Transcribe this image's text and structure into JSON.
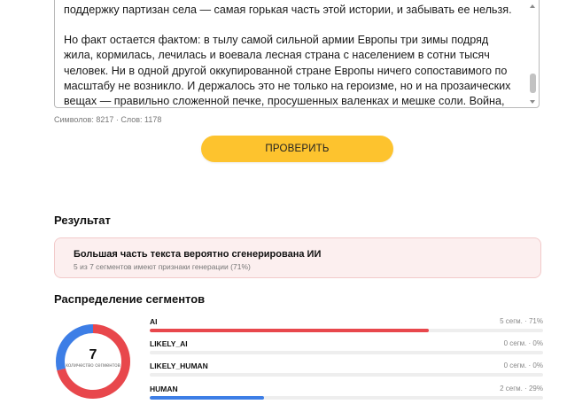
{
  "editor": {
    "line_top": "поддержку партизан села — самая горькая часть этой истории, и забывать ее нельзя.",
    "paragraph": "Но факт остается фактом: в тылу самой сильной армии Европы три зимы подряд жила, кормилась, лечилась и воевала лесная страна с населением в сотни тысяч человек. Ни в одной другой оккупированной стране Европы ничего сопоставимого по масштабу не возникло. И держалось это не только на героизме, но и на прозаических вещах — правильно сложенной печке, просушенных валенках и мешке соли. Война, как известно, выигрывается бытом не в меньшей степени, чем боем."
  },
  "counter": "Символов: 8217 · Слов: 1178",
  "check_button": "ПРОВЕРИТЬ",
  "result": {
    "title": "Результат",
    "alert_title": "Большая часть текста вероятно сгенерирована ИИ",
    "alert_sub": "5 из 7 сегментов имеют признаки генерации (71%)"
  },
  "distribution": {
    "title": "Распределение сегментов",
    "total": "7",
    "total_label": "количество сегментов",
    "rows": [
      {
        "name": "AI",
        "count": "5 сегм. · 71%",
        "fraction": 0.71,
        "color": "#e8474c"
      },
      {
        "name": "LIKELY_AI",
        "count": "0 сегм. · 0%",
        "fraction": 0,
        "color": "#f08a5d"
      },
      {
        "name": "LIKELY_HUMAN",
        "count": "0 сегм. · 0%",
        "fraction": 0,
        "color": "#6fa8f0"
      },
      {
        "name": "HUMAN",
        "count": "2 сегм. · 29%",
        "fraction": 0.29,
        "color": "#3d7ee6"
      }
    ]
  },
  "colors": {
    "accent_button": "#fdc32e",
    "alert_bg": "#fcefef",
    "ai": "#e8474c",
    "human": "#3d7ee6"
  }
}
